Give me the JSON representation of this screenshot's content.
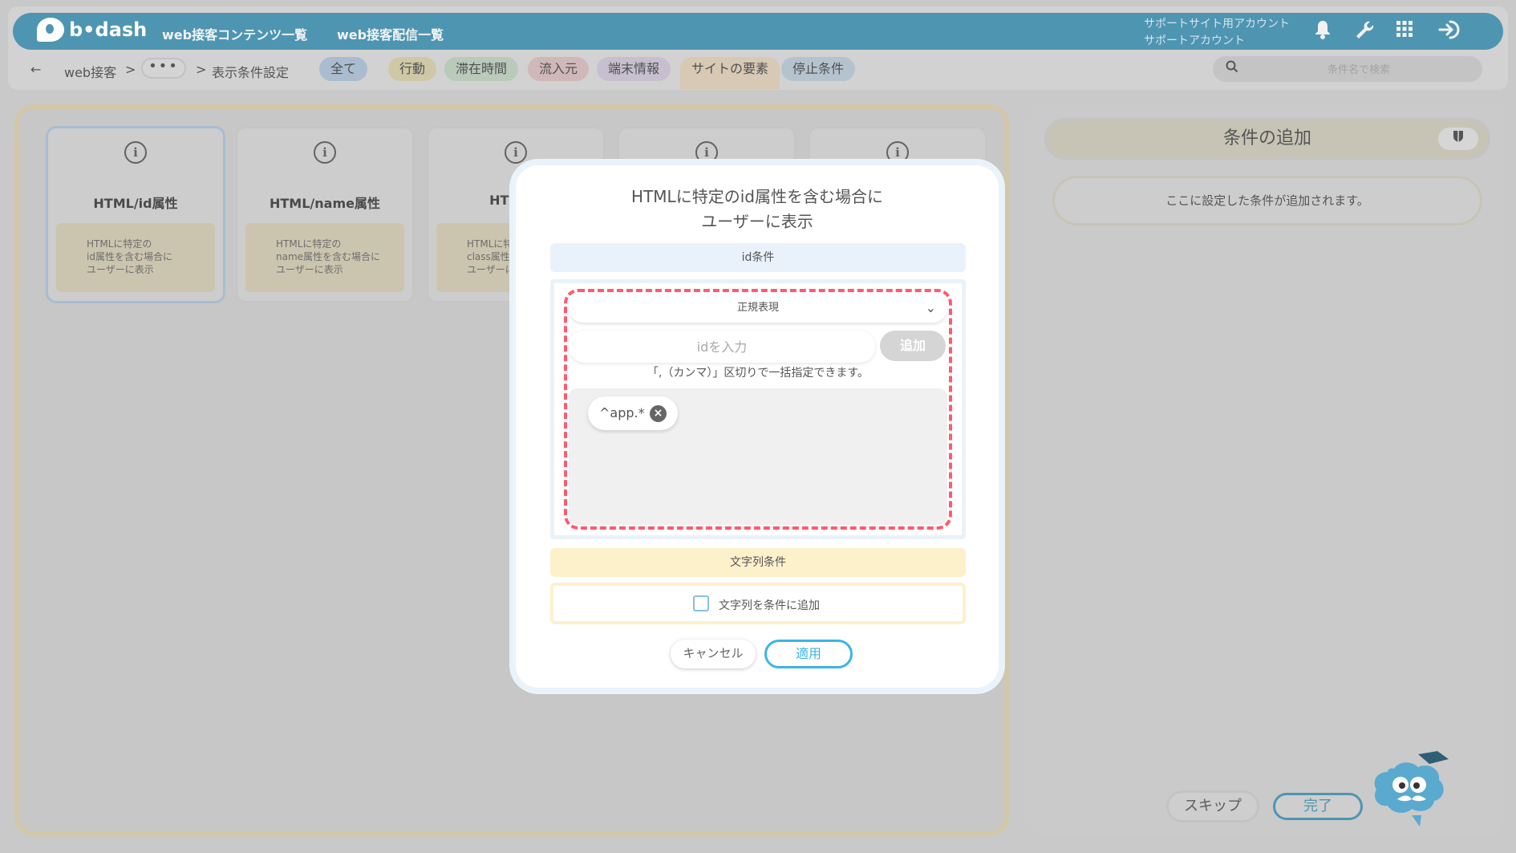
{
  "header": {
    "logo_text": "b•dash",
    "nav": [
      "web接客コンテンツ一覧",
      "web接客配信一覧"
    ],
    "account_line1": "サポートサイト用アカウント",
    "account_line2": "サポートアカウント",
    "icons": [
      "bell-icon",
      "wrench-icon",
      "apps-grid-icon",
      "logout-icon"
    ]
  },
  "breadcrumb": {
    "back": "←",
    "items": [
      "web接客",
      ">",
      "•••",
      ">",
      "表示条件設定"
    ]
  },
  "filter_tabs": [
    {
      "label": "全て",
      "color": "#a9bcd0"
    },
    {
      "label": "行動",
      "color": "#cfc8a6"
    },
    {
      "label": "滞在時間",
      "color": "#b9c9ba"
    },
    {
      "label": "流入元",
      "color": "#d1b8b8"
    },
    {
      "label": "端末情報",
      "color": "#c7bfcf"
    },
    {
      "label": "サイトの要素",
      "color": "#d7c9b4"
    },
    {
      "label": "停止条件",
      "color": "#b5c3cf"
    }
  ],
  "search": {
    "placeholder": "条件名で検索"
  },
  "cards": [
    {
      "title": "HTML/id属性",
      "desc": [
        "HTMLに特定の",
        "id属性を含む場合に",
        "ユーザーに表示"
      ]
    },
    {
      "title": "HTML/name属性",
      "desc": [
        "HTMLに特定の",
        "name属性を含む場合に",
        "ユーザーに表示"
      ]
    },
    {
      "title": "HTML/c",
      "desc": [
        "HTMLに特",
        "class属性を",
        "ユーザーに"
      ]
    },
    {
      "title": "",
      "desc": []
    },
    {
      "title": "",
      "desc": []
    }
  ],
  "side": {
    "title": "条件の追加",
    "hint": "ここに設定した条件が追加されます。",
    "skip": "スキップ",
    "done": "完了"
  },
  "modal": {
    "title_line1": "HTMLに特定のid属性を含む場合に",
    "title_line2": "ユーザーに表示",
    "id_section": "id条件",
    "match_type": "正規表現",
    "id_placeholder": "idを入力",
    "add_button": "追加",
    "hint": "「,（カンマ）」区切りで一括指定できます。",
    "tags": [
      "^app.*"
    ],
    "string_section": "文字列条件",
    "string_checkbox": "文字列を条件に追加",
    "cancel": "キャンセル",
    "apply": "適用"
  },
  "colors": {
    "accent": "#3bb4e8",
    "highlight_dash": "#ff5a6e",
    "id_section_bg": "#e9f2fa",
    "string_section_bg": "#fdf1cc"
  }
}
